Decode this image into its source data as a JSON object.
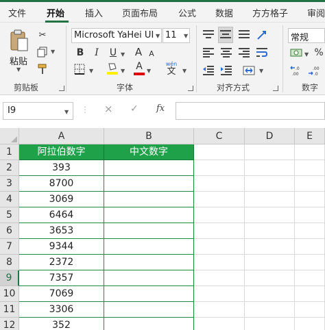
{
  "tabs": [
    "文件",
    "开始",
    "插入",
    "页面布局",
    "公式",
    "数据",
    "方方格子",
    "审阅"
  ],
  "active_tab": "开始",
  "ribbon": {
    "clipboard": {
      "paste_label": "粘贴",
      "group_label": "剪贴板"
    },
    "font": {
      "font_name": "Microsoft YaHei UI",
      "font_size": "11",
      "bold": "B",
      "italic": "I",
      "underline": "U",
      "grow": "A",
      "shrink": "A",
      "font_color_letter": "A",
      "phonetic": "wén",
      "phonetic_char": "文",
      "group_label": "字体"
    },
    "alignment": {
      "group_label": "对齐方式"
    },
    "number": {
      "format": "常规",
      "percent": "%",
      "group_label": "数字"
    }
  },
  "formula_bar": {
    "name_box": "I9",
    "cancel": "×",
    "enter": "✓",
    "fx": "fx",
    "value": ""
  },
  "sheet": {
    "columns": [
      "A",
      "B",
      "C",
      "D",
      "E"
    ],
    "rows": [
      "1",
      "2",
      "3",
      "4",
      "5",
      "6",
      "7",
      "8",
      "9",
      "10",
      "11",
      "12"
    ],
    "selected_row": "9",
    "header": {
      "a": "阿拉伯数字",
      "b": "中文数字"
    },
    "values": [
      "393",
      "8700",
      "3069",
      "6464",
      "3653",
      "9344",
      "2372",
      "7357",
      "7069",
      "3306",
      "352"
    ]
  },
  "colors": {
    "accent": "#217346",
    "header_fill": "#1fa14a",
    "header_text": "#ffffff",
    "ribbon_bg": "#f3f3f3"
  }
}
